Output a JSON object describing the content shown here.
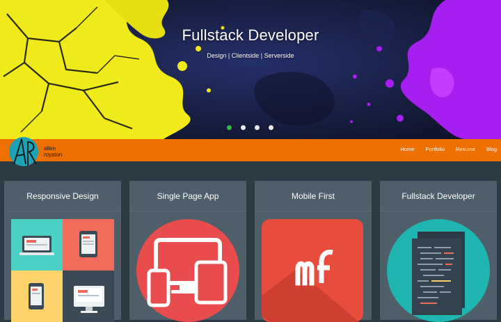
{
  "hero": {
    "title": "Fullstack Developer",
    "subtitle": "Design | Clientside | Serverside",
    "slides": [
      {
        "label": "slide-1",
        "active": true
      },
      {
        "label": "slide-2",
        "active": false
      },
      {
        "label": "slide-3",
        "active": false
      },
      {
        "label": "slide-4",
        "active": false
      }
    ]
  },
  "brand": {
    "logo_initials": "AR",
    "name_line1": "allen",
    "name_line2": "royston"
  },
  "nav": {
    "items": [
      "Home",
      "Portfolio",
      "Resume",
      "Blog"
    ]
  },
  "cards": [
    {
      "title": "Responsive Design",
      "icon": "responsive-devices-icon"
    },
    {
      "title": "Single Page App",
      "icon": "multi-device-icon"
    },
    {
      "title": "Mobile First",
      "icon": "mf-logo-icon"
    },
    {
      "title": "Fullstack Developer",
      "icon": "code-documents-icon"
    }
  ],
  "colors": {
    "nav_orange": "#ee7000",
    "page_bg": "#2c3a44",
    "card_bg": "#4f5f6a",
    "active_dot": "#37b44a",
    "paint_yellow": "#f1ea1a",
    "paint_purple": "#a71ff0"
  }
}
